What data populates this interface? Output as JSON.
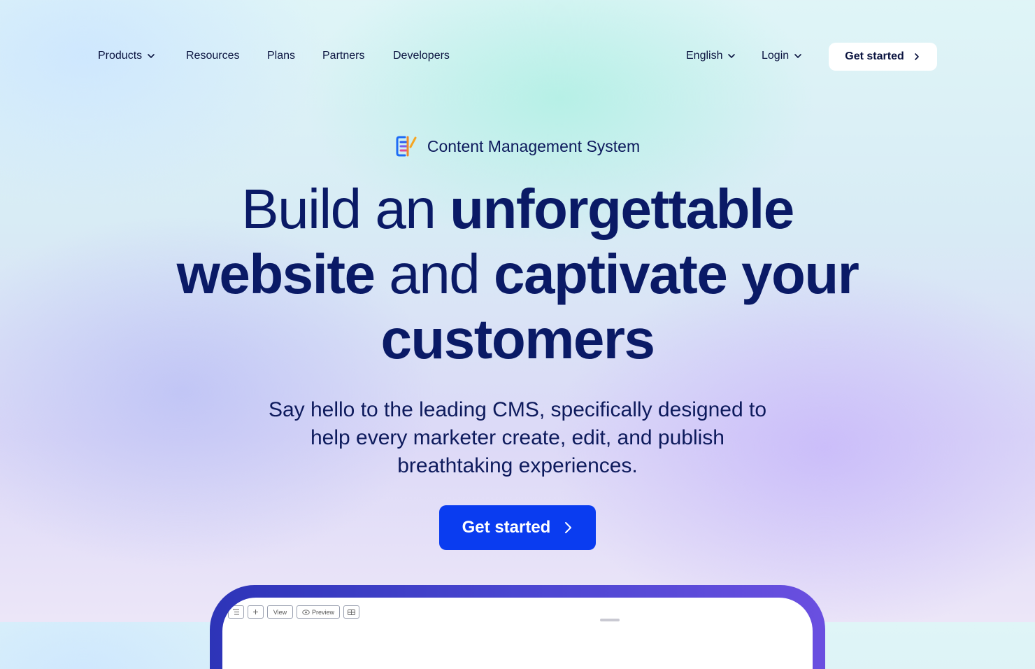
{
  "nav": {
    "items": [
      {
        "label": "Products",
        "dropdown": true
      },
      {
        "label": "Resources",
        "dropdown": false
      },
      {
        "label": "Plans",
        "dropdown": false
      },
      {
        "label": "Partners",
        "dropdown": false
      },
      {
        "label": "Developers",
        "dropdown": false
      }
    ],
    "language": "English",
    "login": "Login",
    "cta": "Get started"
  },
  "hero": {
    "badge": "Content Management System",
    "headline": {
      "part1": "Build an ",
      "bold1": "unforgettable",
      "bold2": "website",
      "part2": " and ",
      "bold3": "captivate your",
      "bold4": "customers"
    },
    "subline1": "Say hello to the leading CMS, specifically designed to",
    "subline2": "help every marketer create, edit, and publish",
    "subline3": "breathtaking experiences.",
    "cta": "Get started"
  },
  "preview": {
    "toolbar": {
      "view": "View",
      "preview": "Preview"
    }
  },
  "colors": {
    "primary": "#0a3cf0",
    "heading": "#0a1a66",
    "frame_start": "#2d34b8",
    "frame_end": "#6a4fe0"
  },
  "icons": [
    "chevron-down-icon",
    "chevron-right-icon",
    "cms-logo-icon",
    "list-icon",
    "plus-icon",
    "eye-icon",
    "layout-icon"
  ]
}
